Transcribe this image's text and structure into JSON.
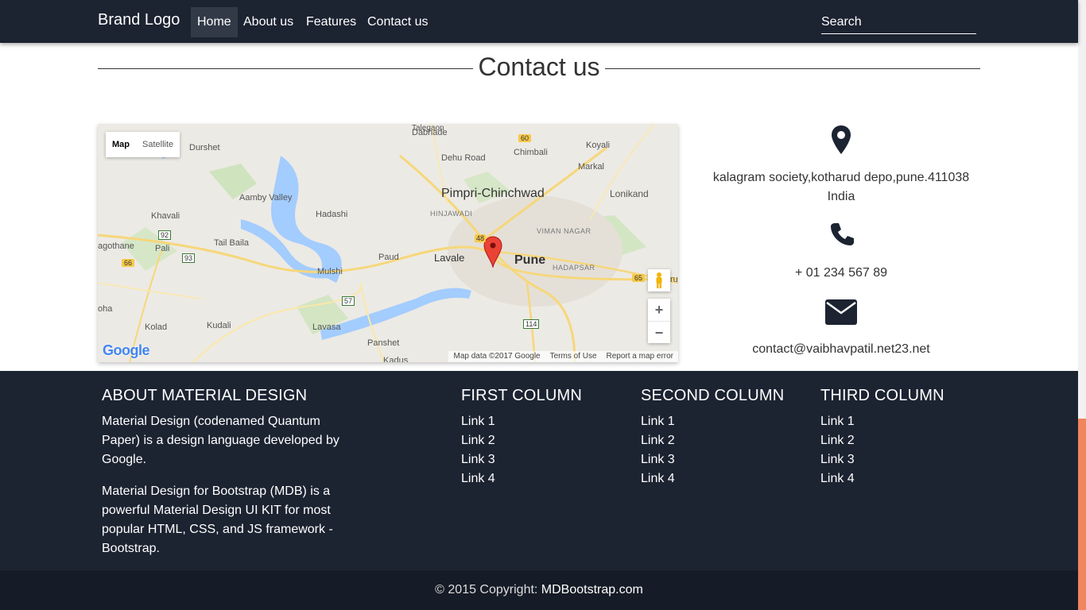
{
  "navbar": {
    "brand": "Brand Logo",
    "items": [
      {
        "label": "Home",
        "active": true
      },
      {
        "label": "About us"
      },
      {
        "label": "Features"
      },
      {
        "label": "Contact us"
      }
    ],
    "search_placeholder": "Search"
  },
  "section": {
    "title": "Contact us"
  },
  "map": {
    "type_map": "Map",
    "type_satellite": "Satellite",
    "zoom_in": "+",
    "zoom_out": "−",
    "logo": "Google",
    "attribution": [
      "Map data ©2017 Google",
      "Terms of Use",
      "Report a map error"
    ],
    "labels": {
      "pimpri": "Pimpri-Chinchwad",
      "pune": "Pune",
      "lavale": "Lavale",
      "paud": "Paud",
      "mulshi": "Mulshi",
      "lavasa": "Lavasa",
      "panshet": "Panshet",
      "kudali": "Kudali",
      "kolad": "Kolad",
      "durshet": "Durshet",
      "aamby": "Aamby Valley",
      "khavali": "Khavali",
      "hadashi": "Hadashi",
      "tailbaila": "Tail Baila",
      "pali": "Pali",
      "agothane": "agothane",
      "dehuroad": "Dehu Road",
      "chimbali": "Chimbali",
      "koyali": "Koyali",
      "markal": "Markal",
      "lonikand": "Lonikand",
      "dabhade": "Dabhade",
      "talegaon": "Talegaon",
      "hinjawadi": "HINJAWADI",
      "vimannagar": "VIMAN NAGAR",
      "hadapsar": "HADAPSAR",
      "kadus": "Kadus",
      "roha": "oha",
      "ru": "ru"
    },
    "shields": [
      "60",
      "92",
      "66",
      "93",
      "48",
      "57",
      "114",
      "65"
    ]
  },
  "contact": {
    "address_line1": "kalagram society,kotharud depo,pune.411038",
    "address_line2": "India",
    "phone": "+ 01 234 567 89",
    "email": "contact@vaibhavpatil.net23.net"
  },
  "footer": {
    "about_title": "ABOUT MATERIAL DESIGN",
    "about_p1": "Material Design (codenamed Quantum Paper) is a design language developed by Google.",
    "about_p2": "Material Design for Bootstrap (MDB) is a powerful Material Design UI KIT for most popular HTML, CSS, and JS framework - Bootstrap.",
    "columns": [
      {
        "title": "FIRST COLUMN",
        "links": [
          "Link 1",
          "Link 2",
          "Link 3",
          "Link 4"
        ]
      },
      {
        "title": "SECOND COLUMN",
        "links": [
          "Link 1",
          "Link 2",
          "Link 3",
          "Link 4"
        ]
      },
      {
        "title": "THIRD COLUMN",
        "links": [
          "Link 1",
          "Link 2",
          "Link 3",
          "Link 4"
        ]
      }
    ],
    "copyright_prefix": "© 2015 Copyright: ",
    "copyright_link": "MDBootstrap.com"
  },
  "colors": {
    "navbar": "#1c2331",
    "footer_bottom": "#161c27",
    "scroll_thumb": "#f0855e"
  }
}
